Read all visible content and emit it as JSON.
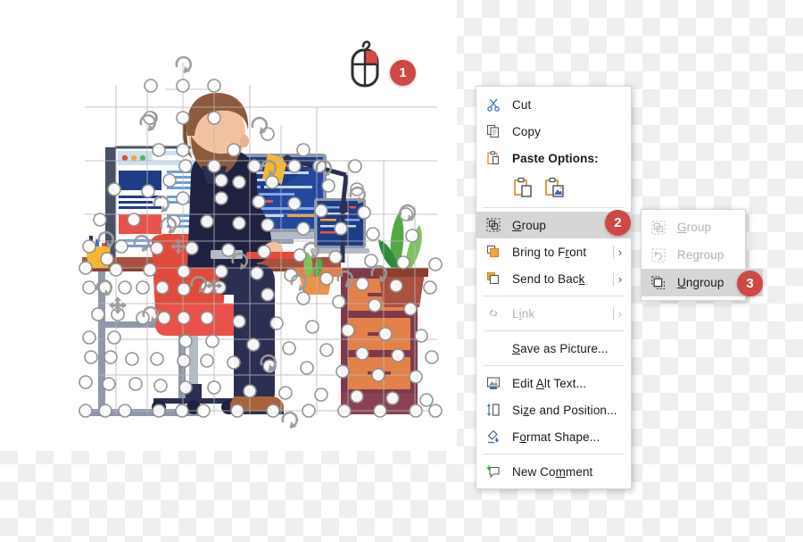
{
  "app": {
    "background": "transparency-checkerboard",
    "accent_badge_color": "#cf4747",
    "highlight_color": "#d6d6d6"
  },
  "illustration": {
    "name": "developer-at-desk-illustration",
    "description": "Flat vector illustration of a bearded man sitting in a red office chair at a desk with two monitors, a laptop, a desk lamp, a potted plant and drawers; overlaid with many selection handles and rotation handles indicating a selected grouped graphic.",
    "selection_state": "grouped-shapes-selected"
  },
  "steps": [
    {
      "number": "1",
      "target": "right-click-mouse"
    },
    {
      "number": "2",
      "target": "group-menu-item"
    },
    {
      "number": "3",
      "target": "ungroup-submenu-item"
    }
  ],
  "mouse": {
    "name": "right-click-mouse-icon",
    "highlighted_button": "right",
    "highlight_color": "#cf4747"
  },
  "context_menu": {
    "name": "shape-context-menu",
    "items": [
      {
        "label": "Cut",
        "accel": "t",
        "icon": "scissors-icon",
        "type": "item",
        "state": "enabled",
        "bold": false,
        "submenu": false
      },
      {
        "label": "Copy",
        "accel": "C",
        "icon": "copy-icon",
        "type": "item",
        "state": "enabled",
        "bold": false,
        "submenu": false
      },
      {
        "label": "Paste Options:",
        "accel": "",
        "icon": "paste-icon",
        "type": "header",
        "state": "enabled",
        "bold": true,
        "submenu": false
      },
      {
        "label": "",
        "type": "paste-options",
        "options": [
          {
            "label": "Keep Source Formatting",
            "icon": "paste-keep-source-formatting-icon"
          },
          {
            "label": "Picture",
            "icon": "paste-picture-icon"
          }
        ]
      },
      {
        "type": "separator"
      },
      {
        "label": "Group",
        "accel": "G",
        "icon": "group-icon",
        "type": "item",
        "state": "highlighted",
        "bold": false,
        "submenu": true,
        "badge": "2"
      },
      {
        "label": "Bring to Front",
        "accel": "r",
        "icon": "bring-to-front-icon",
        "type": "item",
        "state": "enabled",
        "bold": false,
        "submenu": true
      },
      {
        "label": "Send to Back",
        "accel": "k",
        "icon": "send-to-back-icon",
        "type": "item",
        "state": "enabled",
        "bold": false,
        "submenu": true
      },
      {
        "type": "separator"
      },
      {
        "label": "Link",
        "accel": "i",
        "icon": "link-icon",
        "type": "item",
        "state": "disabled",
        "bold": false,
        "submenu": true
      },
      {
        "type": "separator"
      },
      {
        "label": "Save as Picture...",
        "accel": "S",
        "icon": "none",
        "type": "item",
        "state": "enabled",
        "bold": false,
        "submenu": false
      },
      {
        "type": "separator"
      },
      {
        "label": "Edit Alt Text...",
        "accel": "A",
        "icon": "edit-alt-text-icon",
        "type": "item",
        "state": "enabled",
        "bold": false,
        "submenu": false
      },
      {
        "label": "Size and Position...",
        "accel": "z",
        "icon": "size-and-position-icon",
        "type": "item",
        "state": "enabled",
        "bold": false,
        "submenu": false
      },
      {
        "label": "Format Shape...",
        "accel": "o",
        "icon": "format-shape-icon",
        "type": "item",
        "state": "enabled",
        "bold": false,
        "submenu": false
      },
      {
        "type": "separator"
      },
      {
        "label": "New Comment",
        "accel": "m",
        "icon": "new-comment-icon",
        "type": "item",
        "state": "enabled",
        "bold": false,
        "submenu": false
      }
    ]
  },
  "submenu": {
    "name": "group-submenu",
    "items": [
      {
        "label": "Group",
        "accel": "G",
        "icon": "group-icon",
        "state": "disabled"
      },
      {
        "label": "Regroup",
        "accel": "g",
        "icon": "regroup-icon",
        "state": "disabled"
      },
      {
        "label": "Ungroup",
        "accel": "U",
        "icon": "ungroup-icon",
        "state": "highlighted",
        "badge": "3"
      }
    ]
  },
  "labels": {
    "cut": "Cut",
    "copy": "Copy",
    "paste_options": "Paste Options:",
    "group": "Group",
    "bring_to_front": "Bring to Front",
    "send_to_back": "Send to Back",
    "link": "Link",
    "save_as_picture": "Save as Picture...",
    "edit_alt_text": "Edit Alt Text...",
    "size_and_position": "Size and Position...",
    "format_shape": "Format Shape...",
    "new_comment": "New Comment",
    "sub_group": "Group",
    "sub_regroup": "Regroup",
    "sub_ungroup": "Ungroup",
    "badge1": "1",
    "badge2": "2",
    "badge3": "3"
  }
}
